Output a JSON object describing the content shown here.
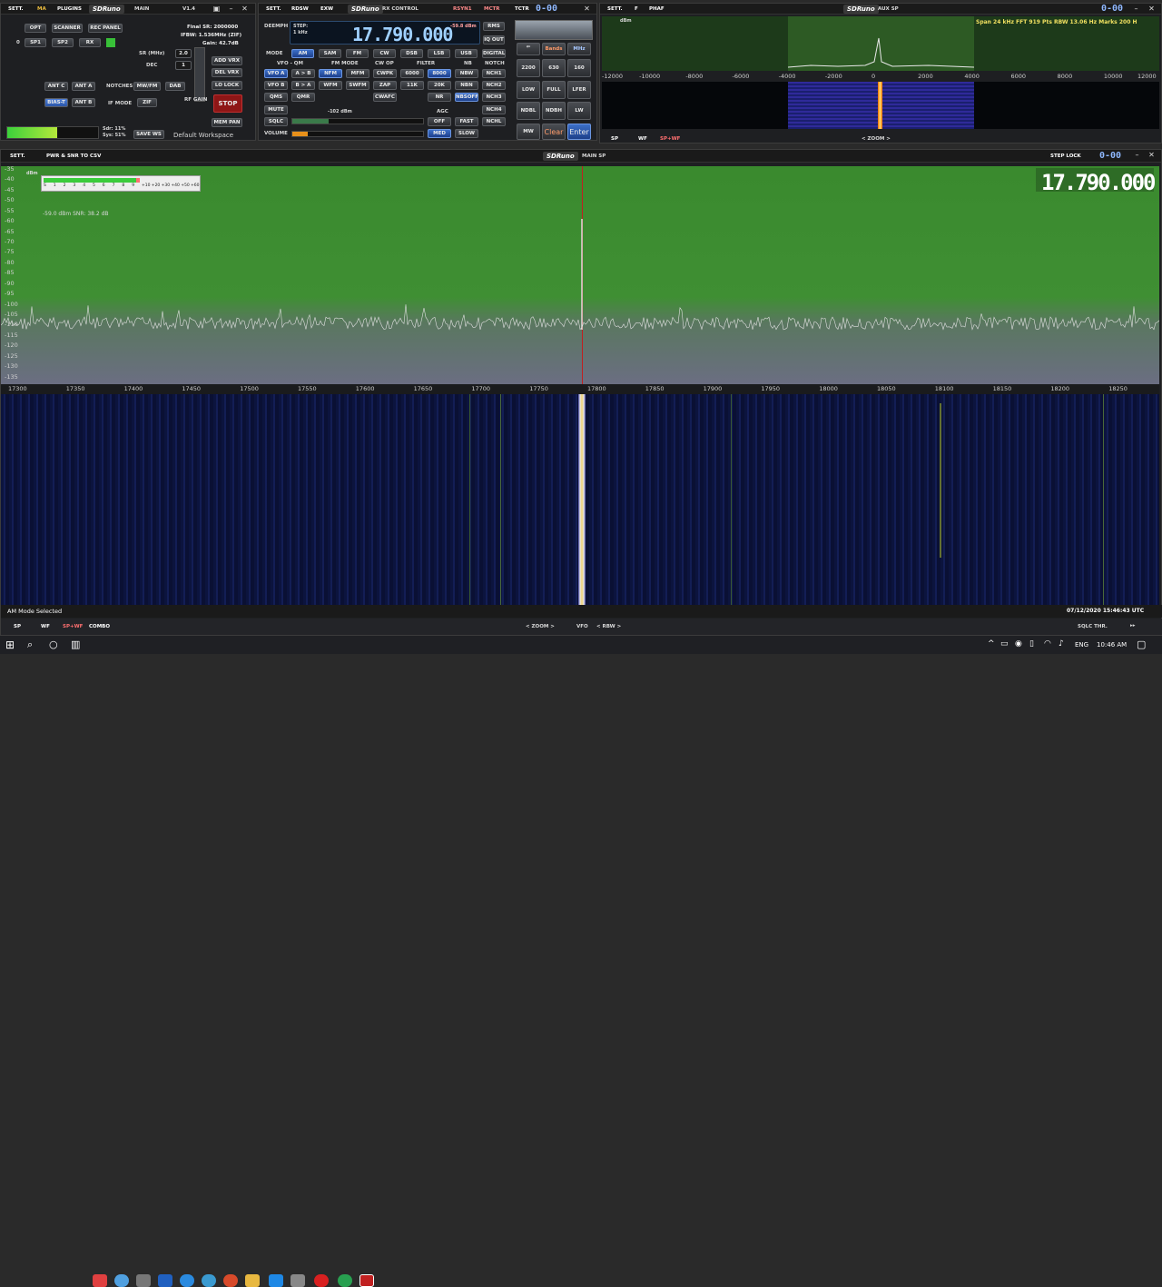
{
  "main": {
    "tabs": [
      "SETT.",
      "MA",
      "PLUGINS"
    ],
    "brand": "SDRuno",
    "subtitle": "MAIN",
    "version": "V1.4",
    "row1": [
      "OPT",
      "SCANNER",
      "REC PANEL"
    ],
    "row2_num": "0",
    "row2": [
      "SP1",
      "SP2",
      "RX"
    ],
    "final_sr": "Final SR: 2000000",
    "ifbw": "IFBW: 1.536MHz (ZIF)",
    "gain": "Gain: 42.7dB",
    "sr_label": "SR (MHz)",
    "sr_value": "2.0",
    "dec_label": "DEC",
    "dec_value": "1",
    "add_vrx": "ADD VRX",
    "del_vrx": "DEL VRX",
    "lo_lock": "LO LOCK",
    "ant_c": "ANT C",
    "ant_a": "ANT A",
    "notches": "NOTCHES",
    "mwfm": "MW/FM",
    "dab": "DAB",
    "bias_t": "BIAS-T",
    "ant_b": "ANT B",
    "if_mode": "IF MODE",
    "zif": "ZIF",
    "rf_gain": "RF GAIN",
    "stop": "STOP",
    "mem_pan": "MEM PAN",
    "sdr_load": "Sdr: 11%",
    "sys_load": "Sys: 51%",
    "save_ws": "SAVE WS",
    "workspace": "Default Workspace"
  },
  "rx": {
    "tabs": [
      "SETT.",
      "RDSW",
      "EXW"
    ],
    "brand": "SDRuno",
    "subtitle": "RX CONTROL",
    "right_tabs": [
      "RSYN1",
      "MCTR",
      "TCTR"
    ],
    "demph": "DEEMPH",
    "step": "STEP:",
    "step_val": "1 kHz",
    "freq": "17.790.000",
    "level": "-59.8 dBm",
    "rms": "RMS",
    "iq_out": "IQ OUT",
    "mode_label": "MODE",
    "modes": [
      "AM",
      "SAM",
      "FM",
      "CW",
      "DSB",
      "LSB",
      "USB",
      "DIGITAL"
    ],
    "vfo_qm": "VFO - QM",
    "fm_mode": "FM MODE",
    "cw_op": "CW OP",
    "filter": "FILTER",
    "nb": "NB",
    "notch": "NOTCH",
    "vfo_a": "VFO A",
    "a_to_b": "A > B",
    "nfm": "NFM",
    "mfm": "MFM",
    "cwpk": "CWPK",
    "f6000": "6000",
    "f8000": "8000",
    "nbw": "NBW",
    "nch1": "NCH1",
    "vfo_b": "VFO B",
    "b_to_a": "B > A",
    "wfm": "WFM",
    "swfm": "SWFM",
    "zap": "ZAP",
    "f11k": "11K",
    "f20k": "20K",
    "nbn": "NBN",
    "nch2": "NCH2",
    "qms": "QMS",
    "qmr": "QMR",
    "cwafc": "CWAFC",
    "nr": "NR",
    "nbsoff": "NBSOFF",
    "nch3": "NCH3",
    "mute": "MUTE",
    "squelch_level": "-102 dBm",
    "agc": "AGC",
    "nch4": "NCH4",
    "sqlc": "SQLC",
    "off": "OFF",
    "fast": "FAST",
    "nchl": "NCHL",
    "volume": "VOLUME",
    "med": "MED",
    "slow": "SLOW",
    "volume_fill": 0.12,
    "pad": {
      "bands": "Bands",
      "mhz": "MHz",
      "r1": [
        "2200",
        "630",
        "160"
      ],
      "r2": [
        "LOW",
        "FULL",
        "LFER"
      ],
      "r3": [
        "NDBL",
        "NDBH",
        "LW"
      ],
      "mw": "MW",
      "clear": "Clear",
      "enter": "Enter"
    }
  },
  "aux": {
    "tabs": [
      "SETT.",
      "F",
      "PHAF"
    ],
    "brand": "SDRuno",
    "subtitle": "AUX SP",
    "info": "Span 24 kHz  FFT 919 Pts  RBW 13.06 Hz  Marks 200 H",
    "db_label": "dBm",
    "scale": [
      "-12000",
      "-10000",
      "-8000",
      "-6000",
      "-4000",
      "-2000",
      "0",
      "2000",
      "4000",
      "6000",
      "8000",
      "10000",
      "12000"
    ],
    "bottom": [
      "SP",
      "WF",
      "SP+WF"
    ],
    "zoom": "ZOOM"
  },
  "main_sp": {
    "sett": "SETT.",
    "csv": "PWR & SNR TO CSV",
    "brand": "SDRuno",
    "subtitle": "MAIN SP",
    "step_lock": "STEP LOCK",
    "freq": "17.790.000",
    "db_unit": "dBm",
    "db_scale": [
      "-35",
      "-40",
      "-45",
      "-50",
      "-55",
      "-60",
      "-65",
      "-70",
      "-75",
      "-80",
      "-85",
      "-90",
      "-95",
      "-100",
      "-105",
      "-110",
      "-115",
      "-120",
      "-125",
      "-130",
      "-135"
    ],
    "smeter_scale": [
      "S",
      "1",
      "2",
      "3",
      "4",
      "5",
      "6",
      "7",
      "8",
      "9",
      "+10",
      "+20",
      "+30",
      "+40",
      "+50",
      "+60"
    ],
    "readout": "-59.0 dBm   SNR: 38.2 dB",
    "freq_scale": [
      "17300",
      "17350",
      "17400",
      "17450",
      "17500",
      "17550",
      "17600",
      "17650",
      "17700",
      "17750",
      "17800",
      "17850",
      "17900",
      "17950",
      "18000",
      "18050",
      "18100",
      "18150",
      "18200",
      "18250"
    ],
    "status": "AM Mode Selected",
    "timestamp": "07/12/2020 15:46:43 UTC",
    "bottom_left": [
      "SP",
      "WF",
      "SP+WF",
      "COMBO"
    ],
    "zoom": "ZOOM",
    "vfo": "VFO",
    "rbw": "RBW",
    "sqlc_thr": "SQLC THR."
  },
  "taskbar": {
    "lang": "ENG",
    "time": "10:46 AM"
  }
}
